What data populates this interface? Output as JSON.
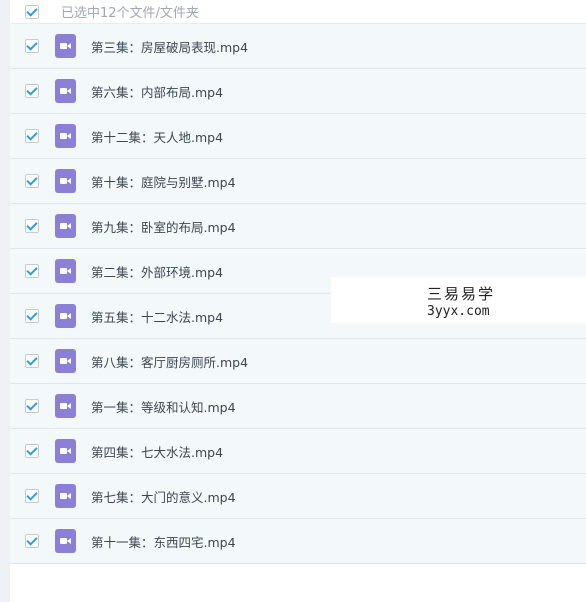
{
  "header": {
    "selection_label": "已选中12个文件/文件夹",
    "select_all_checked": true
  },
  "files": [
    {
      "name": "第三集：房屋破局表现.mp4",
      "checked": true
    },
    {
      "name": "第六集：内部布局.mp4",
      "checked": true
    },
    {
      "name": "第十二集：天人地.mp4",
      "checked": true
    },
    {
      "name": "第十集：庭院与别墅.mp4",
      "checked": true
    },
    {
      "name": "第九集：卧室的布局.mp4",
      "checked": true
    },
    {
      "name": "第二集：外部环境.mp4",
      "checked": true
    },
    {
      "name": "第五集：十二水法.mp4",
      "checked": true
    },
    {
      "name": "第八集：客厅厨房厕所.mp4",
      "checked": true
    },
    {
      "name": "第一集：等级和认知.mp4",
      "checked": true
    },
    {
      "name": "第四集：七大水法.mp4",
      "checked": true
    },
    {
      "name": "第七集：大门的意义.mp4",
      "checked": true
    },
    {
      "name": "第十一集：东西四宅.mp4",
      "checked": true
    }
  ],
  "icons": {
    "checkbox": "checkbox-checked-icon",
    "file": "video-file-icon"
  },
  "colors": {
    "check_accent": "#2f9de0",
    "video_icon": "#8c7fd6",
    "row_background": "#f3f8fb"
  },
  "watermark": {
    "line1": "三易易学",
    "line2": "3yyx.com"
  }
}
